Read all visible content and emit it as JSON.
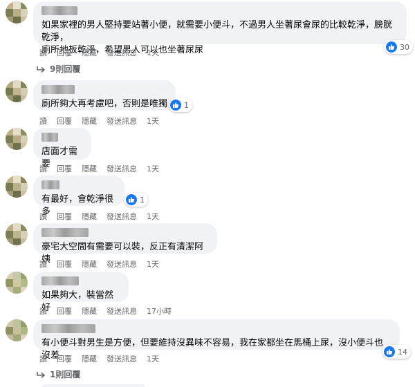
{
  "actions": {
    "read": "讀",
    "reply": "回覆",
    "hide": "隱藏",
    "message": "發送訊息"
  },
  "comments": [
    {
      "text": "如果家裡的男人堅持要站著小便，就需要小便斗，不過男人坐著尿會尿的比較乾淨，膀胱乾淨，\n廁所地板乾淨，希望男人可以也坐著尿尿",
      "time": "1天",
      "reactions": "30",
      "replies": "9則回覆"
    },
    {
      "text": "廁所夠大再考慮吧，否則是唯獨",
      "time": "1天",
      "reactions": "1"
    },
    {
      "text": "店面才需要",
      "time": "1天"
    },
    {
      "text": "有最好，會乾淨很多",
      "time": "1天",
      "reactions": "1"
    },
    {
      "text": "豪宅大空間有需要可以裝，反正有清潔阿姨",
      "time": "1天"
    },
    {
      "text": "如果夠大，裝當然好",
      "time": "17小時"
    },
    {
      "text": "有小便斗對男生是方便，但要維持沒異味不容易，我在家都坐在馬桶上尿，沒小便斗也沒差",
      "time": "1天",
      "reactions": "14",
      "replies": "1則回覆"
    }
  ],
  "colors": {
    "bubble": "#f0f2f5",
    "meta": "#65676b",
    "like": "#1877f2"
  }
}
